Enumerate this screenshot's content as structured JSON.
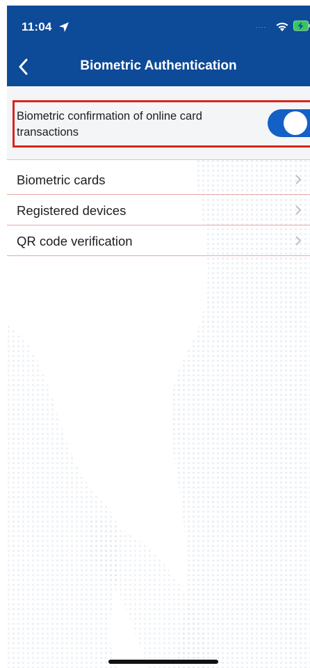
{
  "status_bar": {
    "time": "11:04",
    "signal_text": "....",
    "icons": [
      "location-arrow-icon",
      "wifi-icon",
      "battery-charging-icon"
    ]
  },
  "nav": {
    "title": "Biometric Authentication",
    "back_icon": "chevron-left-icon"
  },
  "toggle_setting": {
    "label": "Biometric confirmation of online card transactions",
    "enabled": true
  },
  "list": {
    "items": [
      {
        "label": "Biometric cards"
      },
      {
        "label": "Registered devices"
      },
      {
        "label": "QR code verification"
      }
    ],
    "chevron_icon": "chevron-right-icon"
  },
  "colors": {
    "header": "#0d4a97",
    "toggle_on": "#1361c6",
    "highlight": "#d9241c",
    "divider": "#e9a8a8"
  }
}
